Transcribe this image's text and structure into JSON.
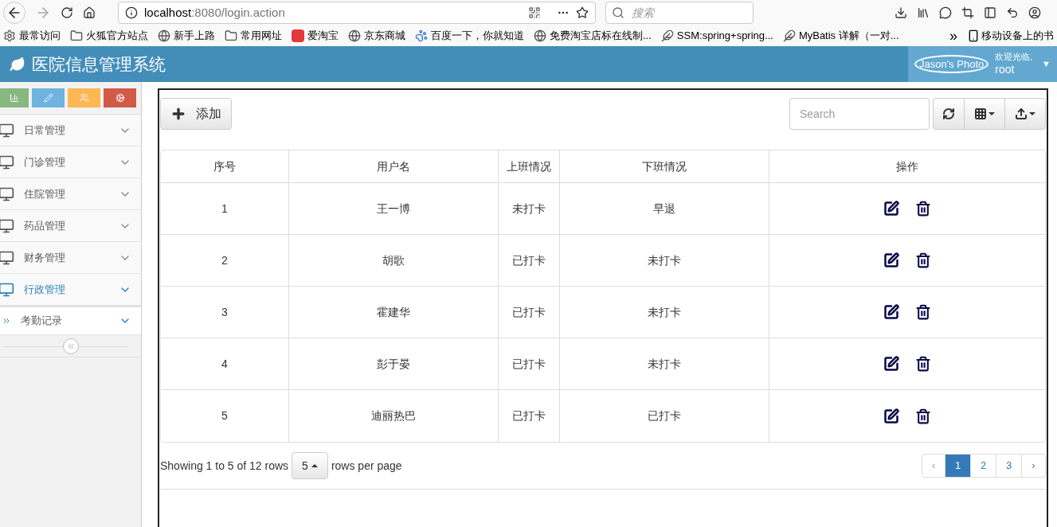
{
  "browser": {
    "url_host": "localhost",
    "url_rest": ":8080/login.action",
    "search_placeholder": "搜索",
    "bookmarks": [
      {
        "kind": "gear",
        "label": "最常访问"
      },
      {
        "kind": "folder",
        "label": "火狐官方站点"
      },
      {
        "kind": "globe",
        "label": "新手上路"
      },
      {
        "kind": "folder",
        "label": "常用网址"
      },
      {
        "kind": "taobao",
        "label": "爱淘宝"
      },
      {
        "kind": "globe",
        "label": "京东商城"
      },
      {
        "kind": "paw",
        "label": "百度一下，你就知道"
      },
      {
        "kind": "globe",
        "label": "免费淘宝店标在线制..."
      },
      {
        "kind": "bird",
        "label": "SSM:spring+spring..."
      },
      {
        "kind": "bird",
        "label": "MyBatis 详解（一对..."
      }
    ],
    "more": "»",
    "mobile": "移动设备上的书"
  },
  "header": {
    "title": "医院信息管理系统",
    "photo_alt": "Jason's Photo",
    "welcome": "欢迎光临,",
    "user": "root",
    "caret": "▼"
  },
  "sidebar": {
    "items": [
      {
        "label": "日常管理",
        "expanded": false
      },
      {
        "label": "门诊管理",
        "expanded": false
      },
      {
        "label": "住院管理",
        "expanded": false
      },
      {
        "label": "药品管理",
        "expanded": false
      },
      {
        "label": "财务管理",
        "expanded": false
      },
      {
        "label": "行政管理",
        "expanded": true,
        "children": [
          {
            "label": "考勤记录",
            "selected": true
          }
        ]
      }
    ]
  },
  "toolbar": {
    "add": "添加",
    "search_placeholder": "Search"
  },
  "table": {
    "columns": [
      "序号",
      "用户名",
      "上班情况",
      "下班情况",
      "操作"
    ],
    "rows": [
      [
        "1",
        "王一博",
        "未打卡",
        "早退"
      ],
      [
        "2",
        "胡歌",
        "已打卡",
        "未打卡"
      ],
      [
        "3",
        "霍建华",
        "已打卡",
        "未打卡"
      ],
      [
        "4",
        "彭于晏",
        "已打卡",
        "未打卡"
      ],
      [
        "5",
        "迪丽热巴",
        "已打卡",
        "已打卡"
      ]
    ]
  },
  "pagination": {
    "showing": "Showing 1 to 5 of 12 rows",
    "page_size": "5",
    "per_page": "rows per page",
    "prev": "‹",
    "next": "›",
    "pages": [
      {
        "label": "1",
        "selected": true
      },
      {
        "label": "2",
        "selected": false
      },
      {
        "label": "3",
        "selected": false
      }
    ]
  }
}
